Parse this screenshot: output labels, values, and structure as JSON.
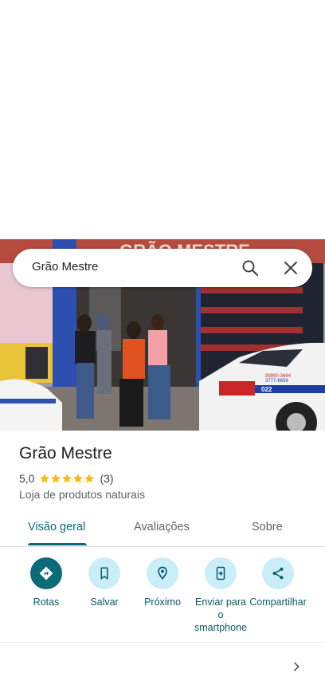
{
  "search": {
    "query": "Grão Mestre"
  },
  "photo": {
    "sign_text": "GRÃO MESTRE",
    "car_plate": "022",
    "car_phone_1": "99990-3664",
    "car_phone_2": "3777-6656"
  },
  "place": {
    "name": "Grão Mestre",
    "rating": "5,0",
    "stars": 5,
    "review_count": "(3)",
    "category": "Loja de produtos naturais"
  },
  "tabs": [
    {
      "label": "Visão geral",
      "active": true
    },
    {
      "label": "Avaliações",
      "active": false
    },
    {
      "label": "Sobre",
      "active": false
    }
  ],
  "actions": [
    {
      "label": "Rotas",
      "icon": "directions-icon"
    },
    {
      "label": "Salvar",
      "icon": "bookmark-icon"
    },
    {
      "label": "Próximo",
      "icon": "nearby-icon"
    },
    {
      "label": "Enviar para o smartphone",
      "icon": "send-to-phone-icon"
    },
    {
      "label": "Compartilhar",
      "icon": "share-icon"
    }
  ],
  "colors": {
    "accent": "#0b6b79",
    "action_bg": "#c9eef8",
    "star": "#fbbc04"
  }
}
